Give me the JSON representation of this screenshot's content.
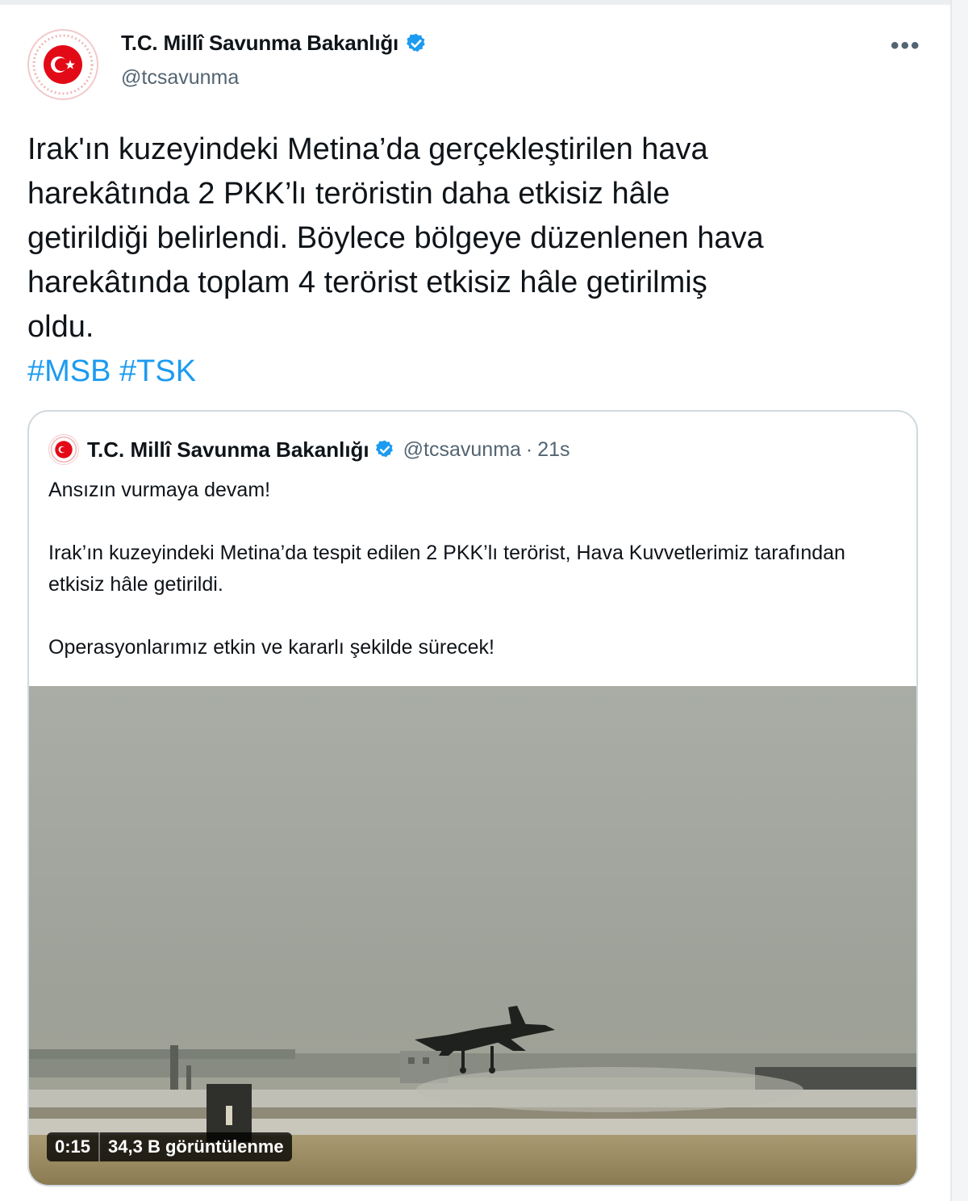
{
  "tweet": {
    "author_name": "T.C. Millî Savunma Bakanlığı",
    "author_handle": "@tcsavunma",
    "more_icon": "more-horizontal-icon",
    "text_lines": [
      "Irak'ın kuzeyindeki Metina’da gerçekleştirilen hava",
      "harekâtında 2 PKK’lı teröristin daha etkisiz hâle",
      "getirildiği belirlendi. Böylece bölgeye düzenlenen hava",
      "harekâtında toplam 4 terörist etkisiz hâle getirilmiş",
      "oldu."
    ],
    "hashtags": [
      "#MSB",
      "#TSK"
    ]
  },
  "quoted_tweet": {
    "author_name": "T.C. Millî Savunma Bakanlığı",
    "author_handle": "@tcsavunma",
    "separator": "·",
    "timestamp": "21s",
    "paragraphs": [
      "Ansızın vurmaya devam!",
      "Irak’ın kuzeyindeki Metina’da tespit edilen 2 PKK’lı terörist, Hava Kuvvetlerimiz tarafından etkisiz hâle getirildi.",
      "Operasyonlarımız etkin ve kararlı şekilde sürecek!"
    ],
    "video": {
      "duration": "0:15",
      "views": "34,3 B görüntülenme",
      "scene": "fighter-jet-takeoff"
    }
  },
  "colors": {
    "hashtag": "#1d9bf0",
    "verified": "#1d9bf0",
    "secondary_text": "#536471",
    "emblem_red": "#e30a17"
  }
}
